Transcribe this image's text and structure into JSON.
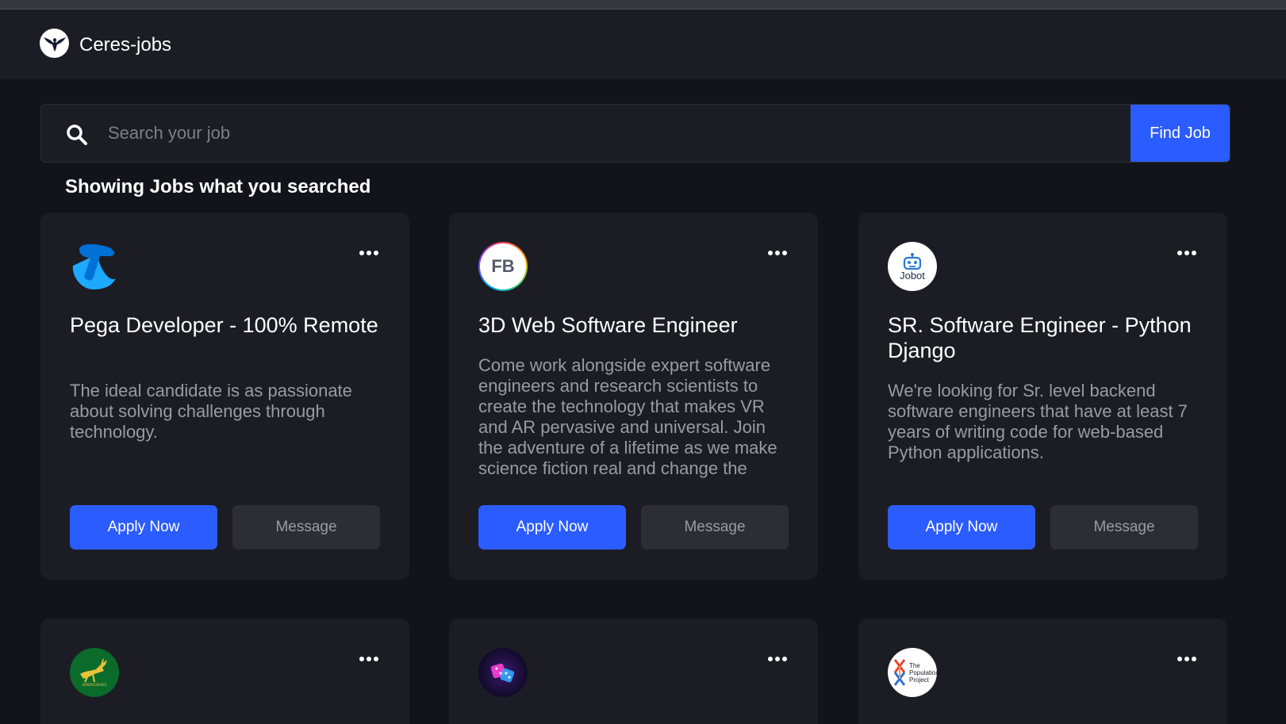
{
  "app": {
    "name": "Ceres-jobs",
    "logo_icon": "eagle-icon"
  },
  "search": {
    "placeholder": "Search your job",
    "value": "",
    "button_label": "Find Job"
  },
  "results": {
    "heading": "Showing Jobs what you searched"
  },
  "colors": {
    "accent": "#2b5cff",
    "background": "#13141b",
    "card": "#1c1d24",
    "muted_button": "#2c2d35"
  },
  "jobs": [
    {
      "logo_icon": "telstra-logo",
      "title": "Pega Developer - 100% Remote",
      "description": "The ideal candidate is as passionate about solving challenges through technology.",
      "apply_label": "Apply Now",
      "message_label": "Message"
    },
    {
      "logo_icon": "fb-logo",
      "logo_text": "FB",
      "title": "3D Web Software Engineer",
      "description": "Come work alongside expert software engineers and research scientists to create the technology that makes VR and AR pervasive and universal. Join the adventure of a lifetime as we make science fiction real and change the world",
      "apply_label": "Apply Now",
      "message_label": "Message"
    },
    {
      "logo_icon": "jobot-logo",
      "logo_text": "Jobot",
      "title": "SR. Software Engineer - Python Django",
      "description": "We're looking for Sr. level backend software engineers that have at least 7 years of writing code for web-based Python applications.",
      "apply_label": "Apply Now",
      "message_label": "Message"
    },
    {
      "logo_icon": "springboks-logo",
      "logo_text": "SPRINGBOKS"
    },
    {
      "logo_icon": "dice-logo"
    },
    {
      "logo_icon": "population-project-logo",
      "logo_text": "The Population Project"
    }
  ]
}
